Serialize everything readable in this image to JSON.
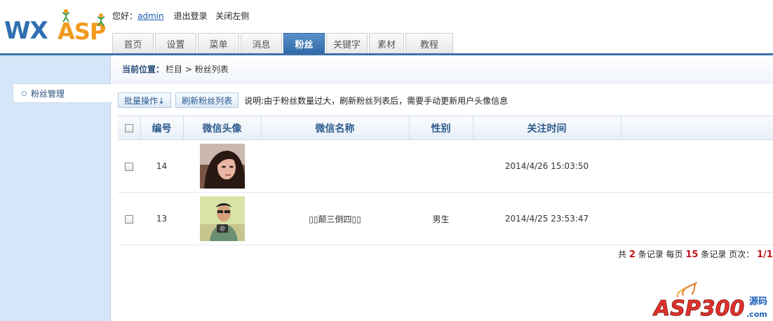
{
  "logo": {
    "text_wx": "WX",
    "text_asp": "ASP"
  },
  "userbar": {
    "greeting": "您好：",
    "username": "admin",
    "logout": "退出登录",
    "close_left": "关闭左侧"
  },
  "tabs": [
    {
      "label": "首页"
    },
    {
      "label": "设置"
    },
    {
      "label": "菜单"
    },
    {
      "label": "消息"
    },
    {
      "label": "粉丝"
    },
    {
      "label": "关键字"
    },
    {
      "label": "素材"
    },
    {
      "label": "教程"
    }
  ],
  "active_tab": "粉丝",
  "sidebar": {
    "items": [
      {
        "label": "粉丝管理"
      }
    ]
  },
  "breadcrumb": {
    "label": "当前位置：",
    "path": "栏目 > 粉丝列表"
  },
  "toolbar": {
    "batch_label": "批量操作↓",
    "refresh_label": "刷新粉丝列表",
    "note": "说明:由于粉丝数量过大，刷新粉丝列表后，需要手动更新用户头像信息"
  },
  "table": {
    "headers": [
      "",
      "编号",
      "微信头像",
      "微信名称",
      "性别",
      "关注时间"
    ],
    "rows": [
      {
        "id": "14",
        "name": "",
        "gender": "",
        "follow_time": "2014/4/26 15:03:50"
      },
      {
        "id": "13",
        "name": "▯▯颠三倒四▯▯",
        "gender": "男生",
        "follow_time": "2014/4/25 23:53:47"
      }
    ]
  },
  "pager": {
    "prefix": "共",
    "total": "2",
    "mid1": "条记录 每页",
    "per_page": "15",
    "mid2": "条记录 页次：",
    "page": "1/1"
  },
  "watermark": {
    "brand": "ASP300",
    "suffix": "源码",
    "domain": ".com"
  },
  "colors": {
    "nav_blue": "#3d72aa",
    "sidebar_bg": "#d4e6f7",
    "pager_red": "#c0171d",
    "logo_orange": "#f29a1e"
  }
}
